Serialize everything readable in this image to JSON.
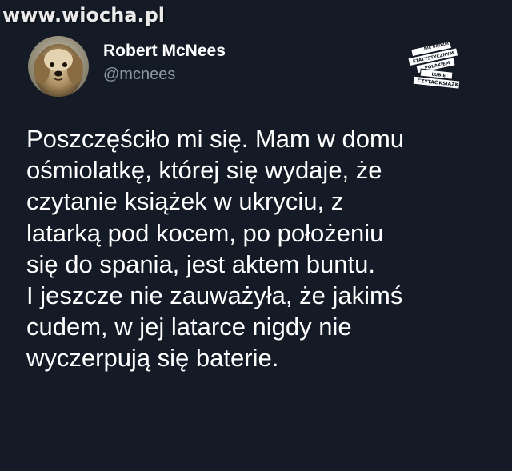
{
  "watermark": "www.wiocha.pl",
  "author": {
    "name": "Robert McNees",
    "handle": "@mcnees"
  },
  "badge": {
    "lines": [
      "NIE BĄDŹMY",
      "STATYSTYCZNYM",
      "POLAKIEM",
      "LUBIĘ",
      "CZYTAĆ",
      "KSIĄŻKI"
    ]
  },
  "tweet": {
    "lines": [
      "Poszczęściło mi się. Mam w domu",
      "ośmiolatkę, której się wydaje, że",
      "czytanie książek w ukryciu, z",
      "latarką pod kocem, po położeniu",
      "się do spania, jest aktem buntu.",
      "I jeszcze nie zauważyła, że jakimś",
      "cudem, w jej latarce nigdy nie",
      "wyczerpują się baterie."
    ]
  },
  "colors": {
    "background": "#141b26",
    "text": "#ffffff",
    "secondary": "#8b98a5"
  }
}
